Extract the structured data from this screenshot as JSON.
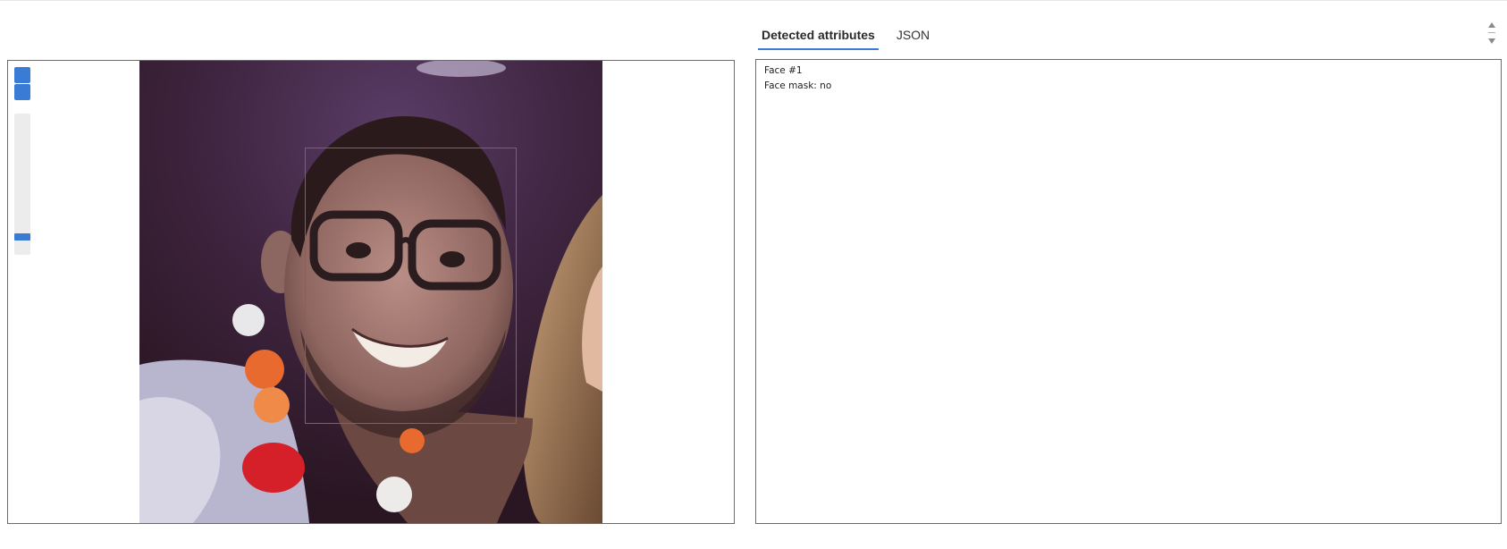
{
  "tabs": [
    {
      "label": "Detected attributes",
      "active": true
    },
    {
      "label": "JSON",
      "active": false
    }
  ],
  "viewer": {
    "zoom_level_fraction": 0.93,
    "icons": [
      "zoom-in-icon",
      "zoom-out-icon"
    ]
  },
  "results": {
    "face_label": "Face #1",
    "mask_line": "Face mask: no"
  },
  "colors": {
    "accent": "#3a7bd5",
    "face_box": "#3d6fd0",
    "panel_border": "#6b6b6b"
  }
}
